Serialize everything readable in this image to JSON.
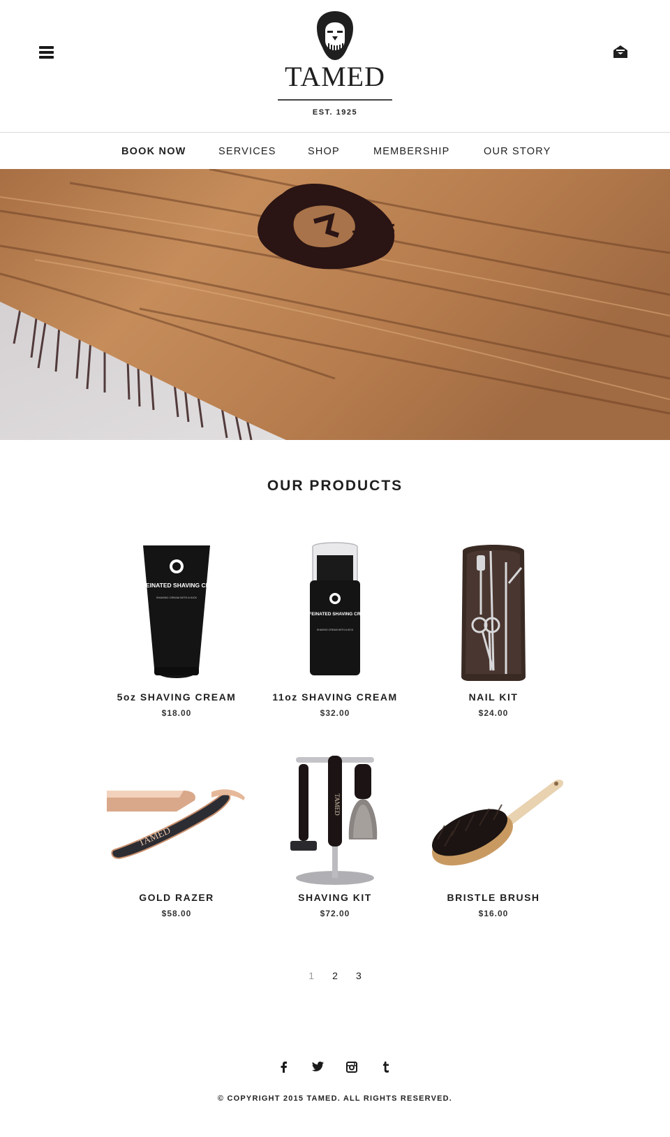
{
  "header": {
    "brand_name": "TAMED",
    "brand_est": "EST. 1925",
    "menu_icon": "hamburger-menu-icon",
    "mail_icon": "envelope-icon"
  },
  "nav": {
    "items": [
      {
        "label": "BOOK NOW",
        "active": true
      },
      {
        "label": "SERVICES",
        "active": false
      },
      {
        "label": "SHOP",
        "active": false
      },
      {
        "label": "MEMBERSHIP",
        "active": false
      },
      {
        "label": "OUR STORY",
        "active": false
      }
    ]
  },
  "hero": {
    "image": "wooden-brush-with-lion-logo",
    "colors": {
      "wood": "#b57a4c",
      "wood_dark": "#7a4a2a",
      "bristle": "#3a2020",
      "background": "#d8d6d8"
    }
  },
  "products": {
    "title": "OUR PRODUCTS",
    "items": [
      {
        "name": "5oz SHAVING CREAM",
        "price": "$18.00",
        "image": "shaving-cream-tube",
        "tube_label": "CAFFEINATED SHAVING CREAM",
        "tube_sublabel": "SHAVING CREAM WITH A KICK"
      },
      {
        "name": "11oz SHAVING CREAM",
        "price": "$32.00",
        "image": "shaving-cream-bottle",
        "tube_label": "CAFFEINATED SHAVING CREAM",
        "tube_sublabel": "SHAVING CREAM WITH A KICK"
      },
      {
        "name": "NAIL KIT",
        "price": "$24.00",
        "image": "nail-kit"
      },
      {
        "name": "GOLD RAZER",
        "price": "$58.00",
        "image": "straight-razor",
        "engraving": "TAMED"
      },
      {
        "name": "SHAVING KIT",
        "price": "$72.00",
        "image": "shaving-kit-stand",
        "engraving": "TAMED"
      },
      {
        "name": "BRISTLE BRUSH",
        "price": "$16.00",
        "image": "bristle-brush"
      }
    ]
  },
  "pagination": {
    "pages": [
      "1",
      "2",
      "3"
    ],
    "current": "1"
  },
  "footer": {
    "social": [
      "facebook-icon",
      "twitter-icon",
      "instagram-icon",
      "tumblr-icon"
    ],
    "copyright": "© COPYRIGHT 2015 TAMED. ALL RIGHTS RESERVED."
  }
}
